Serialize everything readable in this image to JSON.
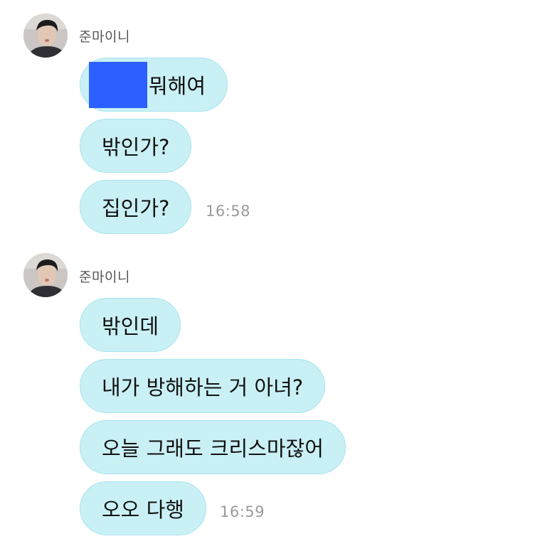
{
  "groups": [
    {
      "sender": "준마이니",
      "messages": [
        {
          "text": "뭐해여",
          "redacted_prefix": true
        },
        {
          "text": "밖인가?"
        },
        {
          "text": "집인가?"
        }
      ],
      "time": "16:58"
    },
    {
      "sender": "준마이니",
      "messages": [
        {
          "text": "밖인데"
        },
        {
          "text": "내가 방해하는 거 아녀?"
        },
        {
          "text": "오늘 그래도 크리스마잖어"
        },
        {
          "text": "오오 다행"
        }
      ],
      "time": "16:59"
    }
  ],
  "colors": {
    "bubble": "#c9f0f5",
    "bubble_border": "#a8e4ee",
    "redaction": "#2b5fff",
    "timestamp": "#9a9a9a",
    "sender": "#555555"
  }
}
